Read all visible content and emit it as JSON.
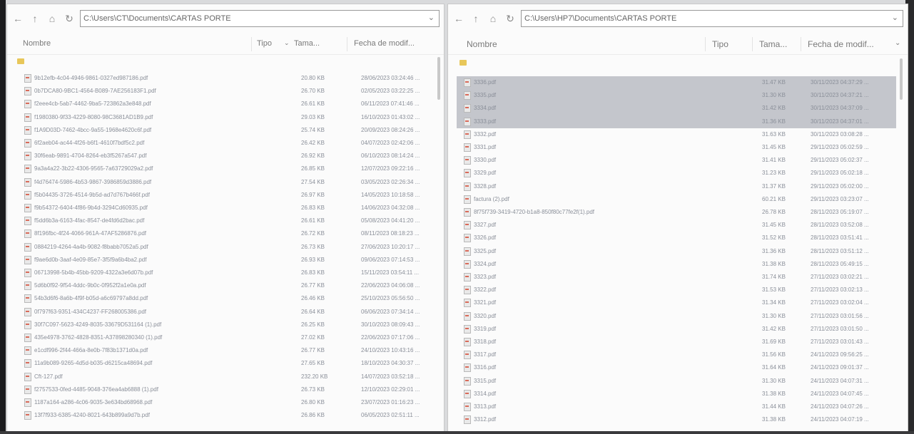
{
  "left": {
    "path": "C:\\Users\\CT\\Documents\\CARTAS PORTE",
    "columns": {
      "name": "Nombre",
      "type": "Tipo",
      "size": "Tama...",
      "date": "Fecha de modif..."
    },
    "files": [
      {
        "name": "9b12efb-4c04-4946-9861-0327ed987186.pdf",
        "size": "20.80 KB",
        "date": "28/06/2023 03:24:46 ..."
      },
      {
        "name": "0b7DCA80-9BC1-4564-B089-7AE256183F1.pdf",
        "size": "26.70 KB",
        "date": "02/05/2023 03:22:25 ..."
      },
      {
        "name": "f2eee4cb-5ab7-4462-9ba5-723862a3e848.pdf",
        "size": "26.61 KB",
        "date": "06/11/2023 07:41:46 ..."
      },
      {
        "name": "f1980380-9f33-4229-8080-98C3681AD1B9.pdf",
        "size": "29.03 KB",
        "date": "16/10/2023 01:43:02 ..."
      },
      {
        "name": "f1A9D03D-7462-4bcc-9a55-1968e4620c6f.pdf",
        "size": "25.74 KB",
        "date": "20/09/2023 08:24:26 ..."
      },
      {
        "name": "6f2aeb04-ac44-4f26-b6f1-4610f7bdf5c2.pdf",
        "size": "26.42 KB",
        "date": "04/07/2023 02:42:06 ..."
      },
      {
        "name": "30f6eab-9891-4704-8264-eb3f5267a547.pdf",
        "size": "26.92 KB",
        "date": "06/10/2023 08:14:24 ..."
      },
      {
        "name": "9a3a4a22-3b22-4306-9565-7a63729029a2.pdf",
        "size": "26.85 KB",
        "date": "12/07/2023 09:22:16 ..."
      },
      {
        "name": "f4d76474-5986-4b53-9867-3986859d3886.pdf",
        "size": "27.54 KB",
        "date": "03/05/2023 02:26:34 ..."
      },
      {
        "name": "f5b04435-3726-4514-9b5d-ad7d767b466f.pdf",
        "size": "26.97 KB",
        "date": "14/05/2023 10:18:58 ..."
      },
      {
        "name": "f9b54372-6404-4f86-9b4d-3294Cd60935.pdf",
        "size": "26.83 KB",
        "date": "14/06/2023 04:32:08 ..."
      },
      {
        "name": "f5dd6b3a-6163-4fac-8547-de4fd6d2bac.pdf",
        "size": "26.61 KB",
        "date": "05/08/2023 04:41:20 ..."
      },
      {
        "name": "8f196fbc-4f24-4066-961A-47AF5286876.pdf",
        "size": "26.72 KB",
        "date": "08/11/2023 08:18:23 ..."
      },
      {
        "name": "0884219-4264-4a4b-9082-f8babb7052a5.pdf",
        "size": "26.73 KB",
        "date": "27/06/2023 10:20:17 ..."
      },
      {
        "name": "f9ae6d0b-3aaf-4e09-85e7-3f5f9a6b4ba2.pdf",
        "size": "26.93 KB",
        "date": "09/06/2023 07:14:53 ..."
      },
      {
        "name": "06713998-5b4b-45bb-9209-4322a3e6d07b.pdf",
        "size": "26.83 KB",
        "date": "15/11/2023 03:54:11 ..."
      },
      {
        "name": "5d6b0f92-9f54-4ddc-9b0c-0f952f2a1e0a.pdf",
        "size": "26.77 KB",
        "date": "22/06/2023 04:06:08 ..."
      },
      {
        "name": "54b3d6f6-8a6b-4f9f-b05d-a6c69797a8dd.pdf",
        "size": "26.46 KB",
        "date": "25/10/2023 05:56:50 ..."
      },
      {
        "name": "0f797f63-9351-434C4237-FF268005386.pdf",
        "size": "26.64 KB",
        "date": "06/06/2023 07:34:14 ..."
      },
      {
        "name": "30f7C097-5623-4249-8035-33679D531164 (1).pdf",
        "size": "26.25 KB",
        "date": "30/10/2023 08:09:43 ..."
      },
      {
        "name": "435e4978-3762-4828-8351-A37898280340 (1).pdf",
        "size": "27.02 KB",
        "date": "22/06/2023 07:17:06 ..."
      },
      {
        "name": "e1cdf996-2f44-466a-8e0b-7f83b1371d0a.pdf",
        "size": "26.77 KB",
        "date": "24/10/2023 10:43:16 ..."
      },
      {
        "name": "11a9b089-9265-4d5d-b035-d6215ca48694.pdf",
        "size": "27.65 KB",
        "date": "18/10/2023 04:30:37 ..."
      },
      {
        "name": "Cft-127.pdf",
        "size": "232.20 KB",
        "date": "14/07/2023 03:52:18 ..."
      },
      {
        "name": "f2757533-0fed-4485-9048-376ea4ab6888 (1).pdf",
        "size": "26.73 KB",
        "date": "12/10/2023 02:29:01 ..."
      },
      {
        "name": "1187a164-a286-4c06-9035-3e634bd68968.pdf",
        "size": "26.80 KB",
        "date": "23/07/2023 01:16:23 ..."
      },
      {
        "name": "13f7f933-6385-4240-8021-643b899a9d7b.pdf",
        "size": "26.86 KB",
        "date": "06/05/2023 02:51:11 ..."
      }
    ]
  },
  "right": {
    "path": "C:\\Users\\HP7\\Documents\\CARTAS PORTE",
    "columns": {
      "name": "Nombre",
      "type": "Tipo",
      "size": "Tama...",
      "date": "Fecha de modif..."
    },
    "files": [
      {
        "name": "3336.pdf",
        "size": "31.47 KB",
        "date": "30/11/2023 04:37:29 ...",
        "selected": true
      },
      {
        "name": "3335.pdf",
        "size": "31.30 KB",
        "date": "30/11/2023 04:37:21 ...",
        "selected": true
      },
      {
        "name": "3334.pdf",
        "size": "31.42 KB",
        "date": "30/11/2023 04:37:09 ...",
        "selected": true
      },
      {
        "name": "3333.pdf",
        "size": "31.36 KB",
        "date": "30/11/2023 04:37:01 ...",
        "selected": true
      },
      {
        "name": "3332.pdf",
        "size": "31.63 KB",
        "date": "30/11/2023 03:08:28 ...",
        "selected": false
      },
      {
        "name": "3331.pdf",
        "size": "31.45 KB",
        "date": "29/11/2023 05:02:59 ...",
        "selected": false
      },
      {
        "name": "3330.pdf",
        "size": "31.41 KB",
        "date": "29/11/2023 05:02:37 ...",
        "selected": false
      },
      {
        "name": "3329.pdf",
        "size": "31.23 KB",
        "date": "29/11/2023 05:02:18 ...",
        "selected": false
      },
      {
        "name": "3328.pdf",
        "size": "31.37 KB",
        "date": "29/11/2023 05:02:00 ...",
        "selected": false
      },
      {
        "name": "factura (2).pdf",
        "size": "60.21 KB",
        "date": "29/11/2023 03:23:07 ...",
        "selected": false
      },
      {
        "name": "8f75f739-3419-4720-b1a8-850f80c77fe2f(1).pdf",
        "size": "26.78 KB",
        "date": "28/11/2023 05:19:07 ...",
        "selected": false
      },
      {
        "name": "3327.pdf",
        "size": "31.45 KB",
        "date": "28/11/2023 03:52:08 ...",
        "selected": false
      },
      {
        "name": "3326.pdf",
        "size": "31.52 KB",
        "date": "28/11/2023 03:51:41 ...",
        "selected": false
      },
      {
        "name": "3325.pdf",
        "size": "31.36 KB",
        "date": "28/11/2023 03:51:12 ...",
        "selected": false
      },
      {
        "name": "3324.pdf",
        "size": "31.38 KB",
        "date": "28/11/2023 05:49:15 ...",
        "selected": false
      },
      {
        "name": "3323.pdf",
        "size": "31.74 KB",
        "date": "27/11/2023 03:02:21 ...",
        "selected": false
      },
      {
        "name": "3322.pdf",
        "size": "31.53 KB",
        "date": "27/11/2023 03:02:13 ...",
        "selected": false
      },
      {
        "name": "3321.pdf",
        "size": "31.34 KB",
        "date": "27/11/2023 03:02:04 ...",
        "selected": false
      },
      {
        "name": "3320.pdf",
        "size": "31.30 KB",
        "date": "27/11/2023 03:01:56 ...",
        "selected": false
      },
      {
        "name": "3319.pdf",
        "size": "31.42 KB",
        "date": "27/11/2023 03:01:50 ...",
        "selected": false
      },
      {
        "name": "3318.pdf",
        "size": "31.69 KB",
        "date": "27/11/2023 03:01:43 ...",
        "selected": false
      },
      {
        "name": "3317.pdf",
        "size": "31.56 KB",
        "date": "24/11/2023 09:56:25 ...",
        "selected": false
      },
      {
        "name": "3316.pdf",
        "size": "31.64 KB",
        "date": "24/11/2023 09:01:37 ...",
        "selected": false
      },
      {
        "name": "3315.pdf",
        "size": "31.30 KB",
        "date": "24/11/2023 04:07:31 ...",
        "selected": false
      },
      {
        "name": "3314.pdf",
        "size": "31.38 KB",
        "date": "24/11/2023 04:07:45 ...",
        "selected": false
      },
      {
        "name": "3313.pdf",
        "size": "31.44 KB",
        "date": "24/11/2023 04:07:26 ...",
        "selected": false
      },
      {
        "name": "3312.pdf",
        "size": "31.38 KB",
        "date": "24/11/2023 04:07:19 ...",
        "selected": false
      }
    ]
  }
}
